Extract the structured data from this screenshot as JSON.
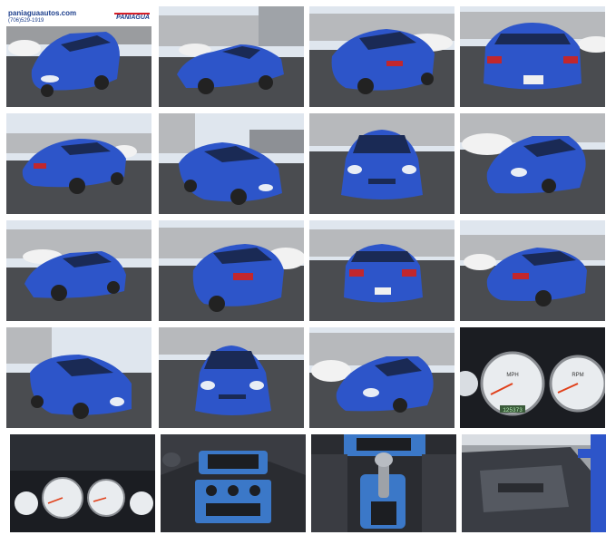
{
  "watermark": {
    "domain": "paniaguaautos.com",
    "phone": "(706)529-1919",
    "logo": "PANIAGUA"
  },
  "colors": {
    "car_blue": "#2d55c9",
    "car_blue_dark": "#1a3a9c",
    "asphalt": "#4a4c50",
    "sky": "#dfe6ee",
    "building": "#b7b9bc",
    "dash": "#1b1d22",
    "gauge": "#e9ecef"
  },
  "gauges": {
    "speedo_unit": "MPH",
    "tacho_unit": "RPM",
    "odometer": "125373"
  },
  "photos": [
    {
      "view": "front-left-lot-watermarked"
    },
    {
      "view": "side-left"
    },
    {
      "view": "rear-left"
    },
    {
      "view": "rear"
    },
    {
      "view": "rear-left-far"
    },
    {
      "view": "front-left-angle"
    },
    {
      "view": "front"
    },
    {
      "view": "front-right"
    },
    {
      "view": "side-left-far"
    },
    {
      "view": "rear-left-close"
    },
    {
      "view": "rear-center"
    },
    {
      "view": "rear-right"
    },
    {
      "view": "front-left-low"
    },
    {
      "view": "front-center-close"
    },
    {
      "view": "front-right-angle"
    },
    {
      "view": "instrument-cluster-close"
    },
    {
      "view": "instrument-cluster"
    },
    {
      "view": "center-console"
    },
    {
      "view": "gear-shifter"
    },
    {
      "view": "door-panel"
    }
  ]
}
